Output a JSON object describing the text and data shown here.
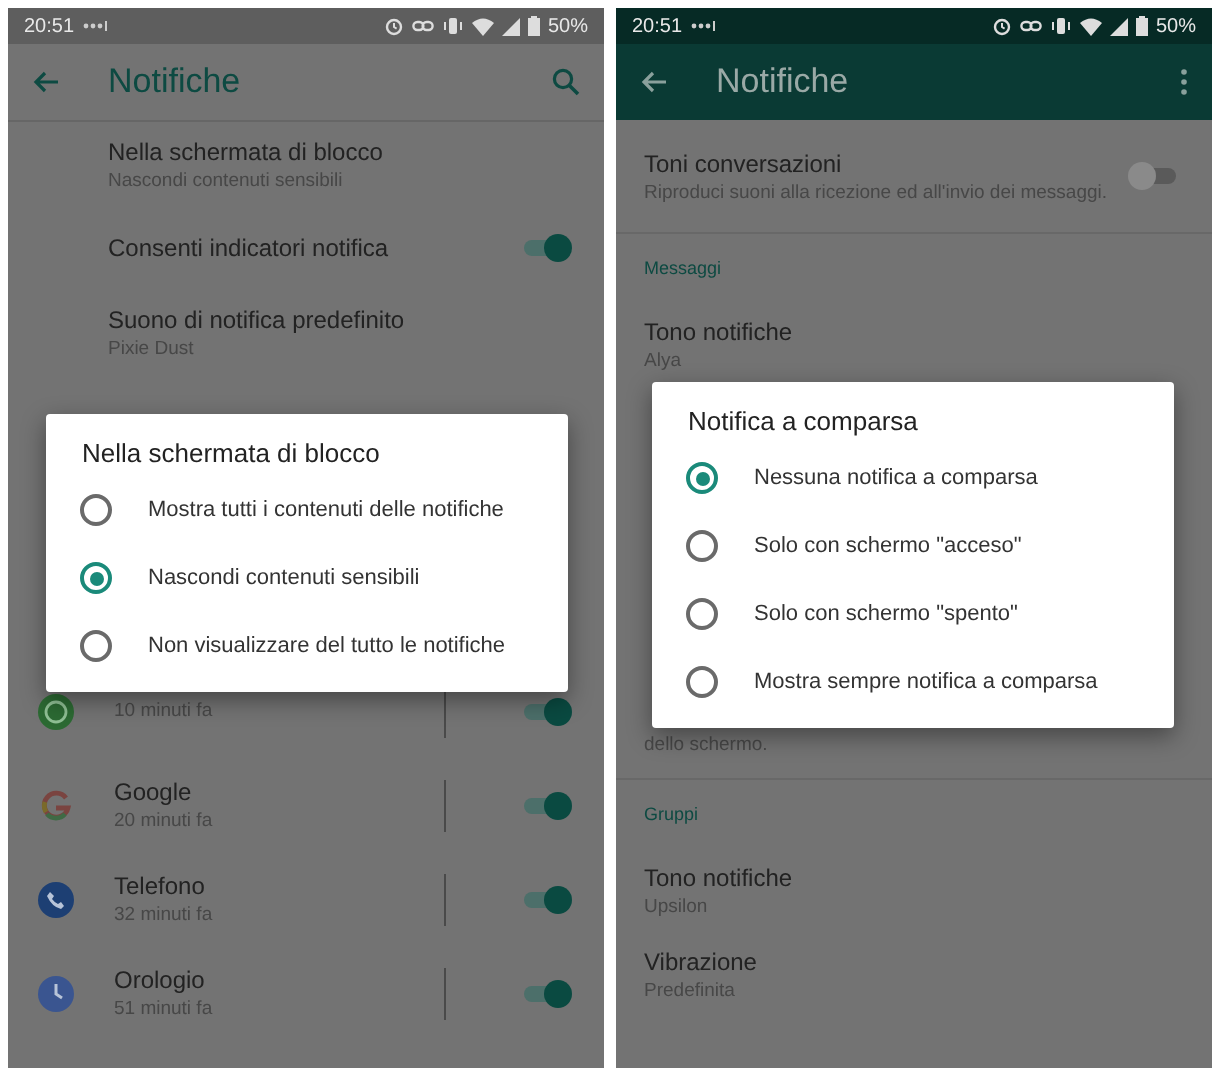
{
  "screens": [
    {
      "status_bar": {
        "time": "20:51",
        "battery": "50%"
      },
      "app_bar": {
        "title": "Notifiche"
      },
      "rows_top": [
        {
          "kind": "setting",
          "title": "Nella schermata di blocco",
          "subtitle": "Nascondi contenuti sensibili"
        },
        {
          "kind": "toggle",
          "title": "Consenti indicatori notifica",
          "on": true
        },
        {
          "kind": "setting",
          "title": "Suono di notifica predefinito",
          "subtitle": "Pixie Dust"
        }
      ],
      "rows_bottom": [
        {
          "kind": "app",
          "subtitle": "10 minuti fa",
          "on": true
        },
        {
          "kind": "app",
          "title": "Google",
          "subtitle": "20 minuti fa",
          "on": true
        },
        {
          "kind": "app",
          "title": "Telefono",
          "subtitle": "32 minuti fa",
          "on": true
        },
        {
          "kind": "app",
          "title": "Orologio",
          "subtitle": "51 minuti fa",
          "on": true
        }
      ],
      "dialog": {
        "title": "Nella schermata di blocco",
        "options": [
          {
            "label": "Mostra tutti i contenuti delle notifiche",
            "selected": false
          },
          {
            "label": "Nascondi contenuti sensibili",
            "selected": true
          },
          {
            "label": "Non visualizzare del tutto le notifiche",
            "selected": false
          }
        ]
      }
    },
    {
      "status_bar": {
        "time": "20:51",
        "battery": "50%"
      },
      "app_bar": {
        "title": "Notifiche"
      },
      "rows_top": [
        {
          "kind": "toggle",
          "title": "Toni conversazioni",
          "subtitle": "Riproduci suoni alla ricezione ed all'invio dei messaggi.",
          "on": false
        },
        {
          "kind": "header",
          "title": "Messaggi"
        },
        {
          "kind": "setting",
          "title": "Tono notifiche",
          "subtitle": "Alya"
        }
      ],
      "rows_bottom": [
        {
          "kind": "note",
          "subtitle": "dello schermo."
        },
        {
          "kind": "header",
          "title": "Gruppi"
        },
        {
          "kind": "setting",
          "title": "Tono notifiche",
          "subtitle": "Upsilon"
        },
        {
          "kind": "setting",
          "title": "Vibrazione",
          "subtitle": "Predefinita"
        }
      ],
      "dialog": {
        "title": "Notifica a comparsa",
        "options": [
          {
            "label": "Nessuna notifica a comparsa",
            "selected": true
          },
          {
            "label": "Solo con schermo \"acceso\"",
            "selected": false
          },
          {
            "label": "Solo con schermo \"spento\"",
            "selected": false
          },
          {
            "label": "Mostra sempre notifica a comparsa",
            "selected": false
          }
        ]
      }
    }
  ]
}
